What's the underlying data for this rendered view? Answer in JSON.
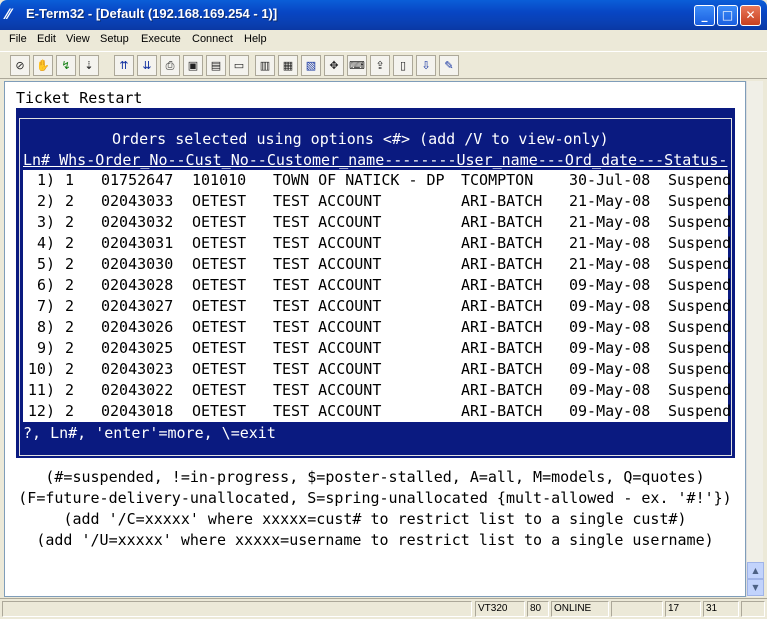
{
  "window": {
    "title": "E-Term32 - [Default (192.168.169.254 - 1)]",
    "minimize": "_",
    "maximize": "□",
    "close": "✕"
  },
  "menu": [
    "File",
    "Edit",
    "View",
    "Setup",
    "Execute",
    "Connect",
    "Help"
  ],
  "toolbar": {
    "icons": [
      "no-entry-icon",
      "hand-icon",
      "connect-icon",
      "disconnect-icon",
      "send-icon",
      "receive-icon",
      "print-icon",
      "copy-icon",
      "paste-icon",
      "rect-icon",
      "screen-80-icon",
      "screen-132-icon",
      "screen-page-icon",
      "cross-icon",
      "keyboard-icon",
      "upload-icon",
      "file-icon",
      "download-icon",
      "pen-icon"
    ],
    "glyphs": [
      "⊘",
      "✋",
      "↯",
      "⇣",
      "⇈",
      "⇊",
      "⎙",
      "▣",
      "▤",
      "▭",
      "▥",
      "▦",
      "▧",
      "✥",
      "⌨",
      "⇪",
      "▯",
      "⇩",
      "✎"
    ]
  },
  "screen": {
    "title": "Ticket Restart",
    "frame_title": "Orders selected using options <#> (add /V to view-only)",
    "header": "Ln# Whs-Order_No--Cust_No--Customer_name--------User_name---Ord_date---Status-",
    "rows": [
      [
        "1)",
        "1",
        "01752647",
        "101010",
        "TOWN OF NATICK - DP",
        "TCOMPTON",
        "30-Jul-08",
        "Suspend"
      ],
      [
        "2)",
        "2",
        "02043033",
        "OETEST",
        "TEST ACCOUNT",
        "ARI-BATCH",
        "21-May-08",
        "Suspend"
      ],
      [
        "3)",
        "2",
        "02043032",
        "OETEST",
        "TEST ACCOUNT",
        "ARI-BATCH",
        "21-May-08",
        "Suspend"
      ],
      [
        "4)",
        "2",
        "02043031",
        "OETEST",
        "TEST ACCOUNT",
        "ARI-BATCH",
        "21-May-08",
        "Suspend"
      ],
      [
        "5)",
        "2",
        "02043030",
        "OETEST",
        "TEST ACCOUNT",
        "ARI-BATCH",
        "21-May-08",
        "Suspend"
      ],
      [
        "6)",
        "2",
        "02043028",
        "OETEST",
        "TEST ACCOUNT",
        "ARI-BATCH",
        "09-May-08",
        "Suspend"
      ],
      [
        "7)",
        "2",
        "02043027",
        "OETEST",
        "TEST ACCOUNT",
        "ARI-BATCH",
        "09-May-08",
        "Suspend"
      ],
      [
        "8)",
        "2",
        "02043026",
        "OETEST",
        "TEST ACCOUNT",
        "ARI-BATCH",
        "09-May-08",
        "Suspend"
      ],
      [
        "9)",
        "2",
        "02043025",
        "OETEST",
        "TEST ACCOUNT",
        "ARI-BATCH",
        "09-May-08",
        "Suspend"
      ],
      [
        "10)",
        "2",
        "02043023",
        "OETEST",
        "TEST ACCOUNT",
        "ARI-BATCH",
        "09-May-08",
        "Suspend"
      ],
      [
        "11)",
        "2",
        "02043022",
        "OETEST",
        "TEST ACCOUNT",
        "ARI-BATCH",
        "09-May-08",
        "Suspend"
      ],
      [
        "12)",
        "2",
        "02043018",
        "OETEST",
        "TEST ACCOUNT",
        "ARI-BATCH",
        "09-May-08",
        "Suspend"
      ]
    ],
    "prompt": "?, Ln#, 'enter'=more, \\=exit",
    "help": [
      "(#=suspended, !=in-progress, $=poster-stalled, A=all, M=models, Q=quotes)",
      "(F=future-delivery-unallocated, S=spring-unallocated {mult-allowed - ex. '#!'})",
      "(add '/C=xxxxx' where xxxxx=cust# to restrict list to a single cust#)",
      "(add '/U=xxxxx' where xxxxx=username to restrict list to a single username)"
    ]
  },
  "scrollbar": {
    "up": "▲",
    "down": "▼"
  },
  "status": {
    "panels": [
      "",
      "VT320",
      "80",
      "ONLINE",
      "",
      "17",
      "31",
      ""
    ]
  },
  "colors": {
    "terminal_blue": "#0a1a80",
    "title_blue": "#0846c4"
  }
}
